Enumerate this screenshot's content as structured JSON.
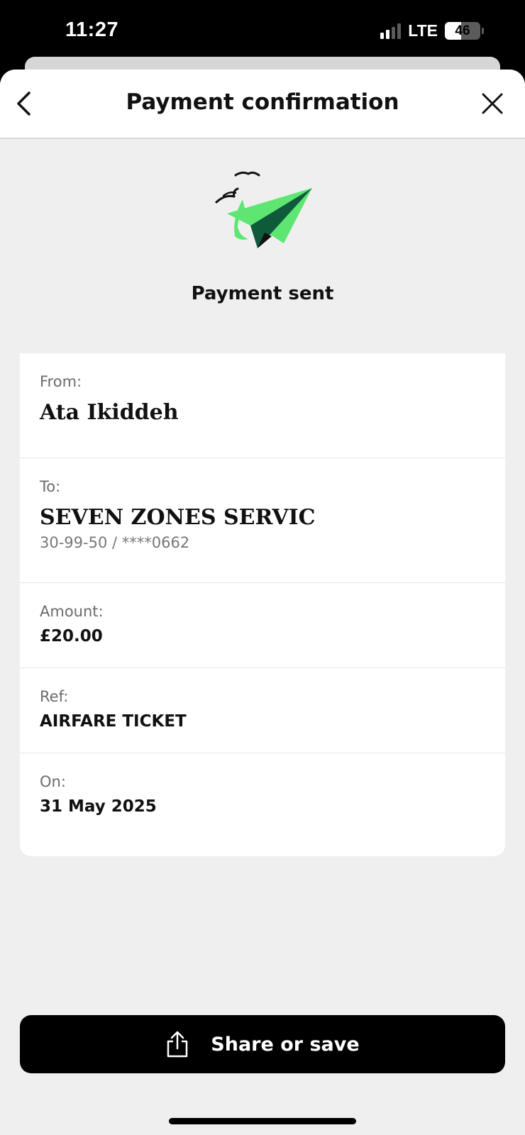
{
  "status_bar": {
    "time": "11:27",
    "network": "LTE",
    "battery": "46",
    "battery_level_percent": 46,
    "signal_bars_active": 2,
    "signal_bars_total": 4
  },
  "header": {
    "title": "Payment confirmation",
    "back_icon": "chevron-left-icon",
    "close_icon": "close-icon"
  },
  "hero": {
    "icon": "paper-plane-icon",
    "text": "Payment sent"
  },
  "details": {
    "from": {
      "label": "From:",
      "value": "Ata Ikiddeh"
    },
    "to": {
      "label": "To:",
      "value": "SEVEN ZONES SERVIC",
      "account": "30-99-50 / ****0662"
    },
    "amount": {
      "label": "Amount:",
      "value": "£20.00"
    },
    "ref": {
      "label": "Ref:",
      "value": "AIRFARE TICKET"
    },
    "on": {
      "label": "On:",
      "value": "31 May 2025"
    }
  },
  "actions": {
    "share_label": "Share or save",
    "share_icon": "share-icon"
  },
  "colors": {
    "accent_green": "#5ee672",
    "dark_green": "#0e5a3a",
    "background": "#efefef",
    "button": "#000000"
  }
}
